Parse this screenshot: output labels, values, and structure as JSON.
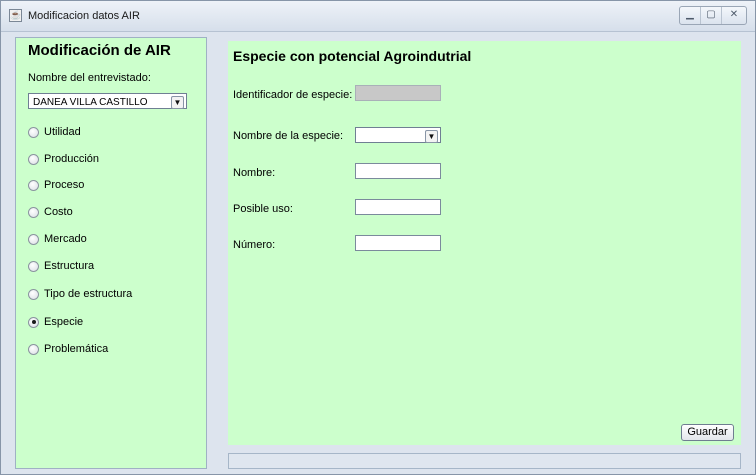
{
  "window": {
    "title": "Modificacion datos  AIR",
    "app_icon": "java-cup-icon",
    "controls": [
      "minimize-icon",
      "maximize-icon",
      "close-icon"
    ]
  },
  "left": {
    "title": "Modificación de AIR",
    "interviewee_label": "Nombre del entrevistado:",
    "interviewee_value": "DANEA VILLA CASTILLO",
    "options": [
      {
        "label": "Utilidad",
        "selected": false
      },
      {
        "label": "Producción",
        "selected": false
      },
      {
        "label": "Proceso",
        "selected": false
      },
      {
        "label": "Costo",
        "selected": false
      },
      {
        "label": "Mercado",
        "selected": false
      },
      {
        "label": "Estructura",
        "selected": false
      },
      {
        "label": "Tipo de estructura",
        "selected": false
      },
      {
        "label": "Especie",
        "selected": true
      },
      {
        "label": "Problemática",
        "selected": false
      }
    ]
  },
  "form": {
    "title": "Especie con potencial Agroindutrial",
    "id_label": "Identificador de especie:",
    "id_value": "",
    "species_label": "Nombre de la especie:",
    "species_value": "",
    "name_label": "Nombre:",
    "name_value": "",
    "use_label": "Posible uso:",
    "use_value": "",
    "number_label": "Número:",
    "number_value": "",
    "save_label": "Guardar"
  },
  "colors": {
    "panel_bg": "#ccffcc",
    "window_bg": "#dde4ee"
  }
}
